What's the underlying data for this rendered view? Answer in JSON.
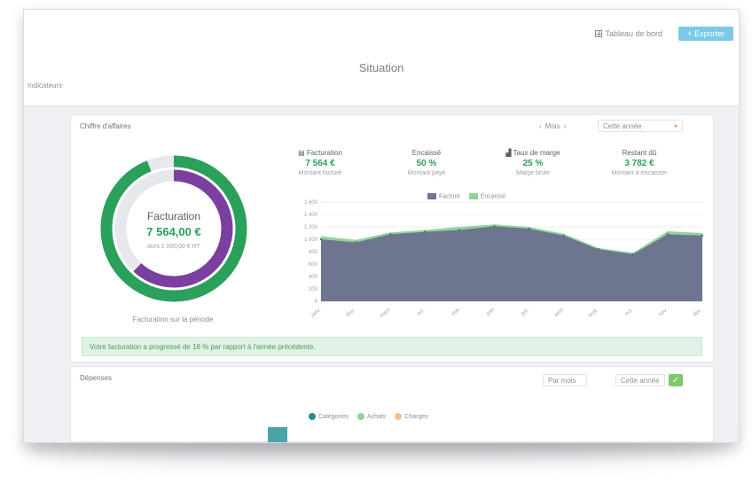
{
  "topbar": {
    "link_label": "Tableau de bord",
    "button_label": "Exporter",
    "page_title": "Situation",
    "left_label": "Indicateurs"
  },
  "panel1": {
    "title": "Chiffre d'affaires",
    "period_control": "Mois",
    "select_label": "Cette année",
    "donut": {
      "title": "Facturation",
      "value": "7 564,00 €",
      "subtitle": "dont 1 000,00 € HT",
      "caption": "Facturation sur la période",
      "outer_fraction": 0.94,
      "inner_fraction": 0.62,
      "outer_color": "#2aa05a",
      "inner_color": "#7b3fa0"
    },
    "kpis": [
      {
        "icon": "document-icon",
        "title": "Facturation",
        "value": "7 564 €",
        "sub": "Montant facturé"
      },
      {
        "icon": "",
        "title": "Encaissé",
        "value": "50 %",
        "sub": "Montant payé"
      },
      {
        "icon": "chart-icon",
        "title": "Taux de marge",
        "value": "25 %",
        "sub": "Marge brute"
      },
      {
        "icon": "",
        "title": "Restant dû",
        "value": "3 782 €",
        "sub": "Montant à encaisser"
      }
    ],
    "legend": [
      {
        "name": "Facturé",
        "color": "#6e7590"
      },
      {
        "name": "Encaissé",
        "color": "#8fd49a"
      }
    ],
    "y_labels": [
      "1 600",
      "1 400",
      "1 200",
      "1 000",
      "800",
      "600",
      "400",
      "200",
      "0"
    ],
    "x_labels": [
      "janv.",
      "févr.",
      "mars",
      "avr.",
      "mai",
      "juin",
      "juil.",
      "août",
      "sept.",
      "oct.",
      "nov.",
      "déc."
    ],
    "alert": "Votre facturation a progressé de 18 % par rapport à l'année précédente."
  },
  "panel2": {
    "title": "Dépenses",
    "control1": "Par mois",
    "control2": "Cette année",
    "legend": [
      {
        "name": "Catégories",
        "color": "#2a8c8f"
      },
      {
        "name": "Achats",
        "color": "#8fd49a"
      },
      {
        "name": "Charges",
        "color": "#f3c08a"
      }
    ]
  },
  "chart_data": {
    "type": "area",
    "categories": [
      "janv.",
      "févr.",
      "mars",
      "avr.",
      "mai",
      "juin",
      "juil.",
      "août",
      "sept.",
      "oct.",
      "nov.",
      "déc."
    ],
    "ylim": [
      0,
      1600
    ],
    "series": [
      {
        "name": "Facturé",
        "values": [
          1000,
          950,
          1080,
          1120,
          1150,
          1210,
          1170,
          1060,
          840,
          760,
          1080,
          1060
        ]
      },
      {
        "name": "Encaissé",
        "values": [
          1050,
          990,
          1110,
          1150,
          1200,
          1240,
          1200,
          1090,
          860,
          780,
          1130,
          1100
        ]
      }
    ]
  }
}
